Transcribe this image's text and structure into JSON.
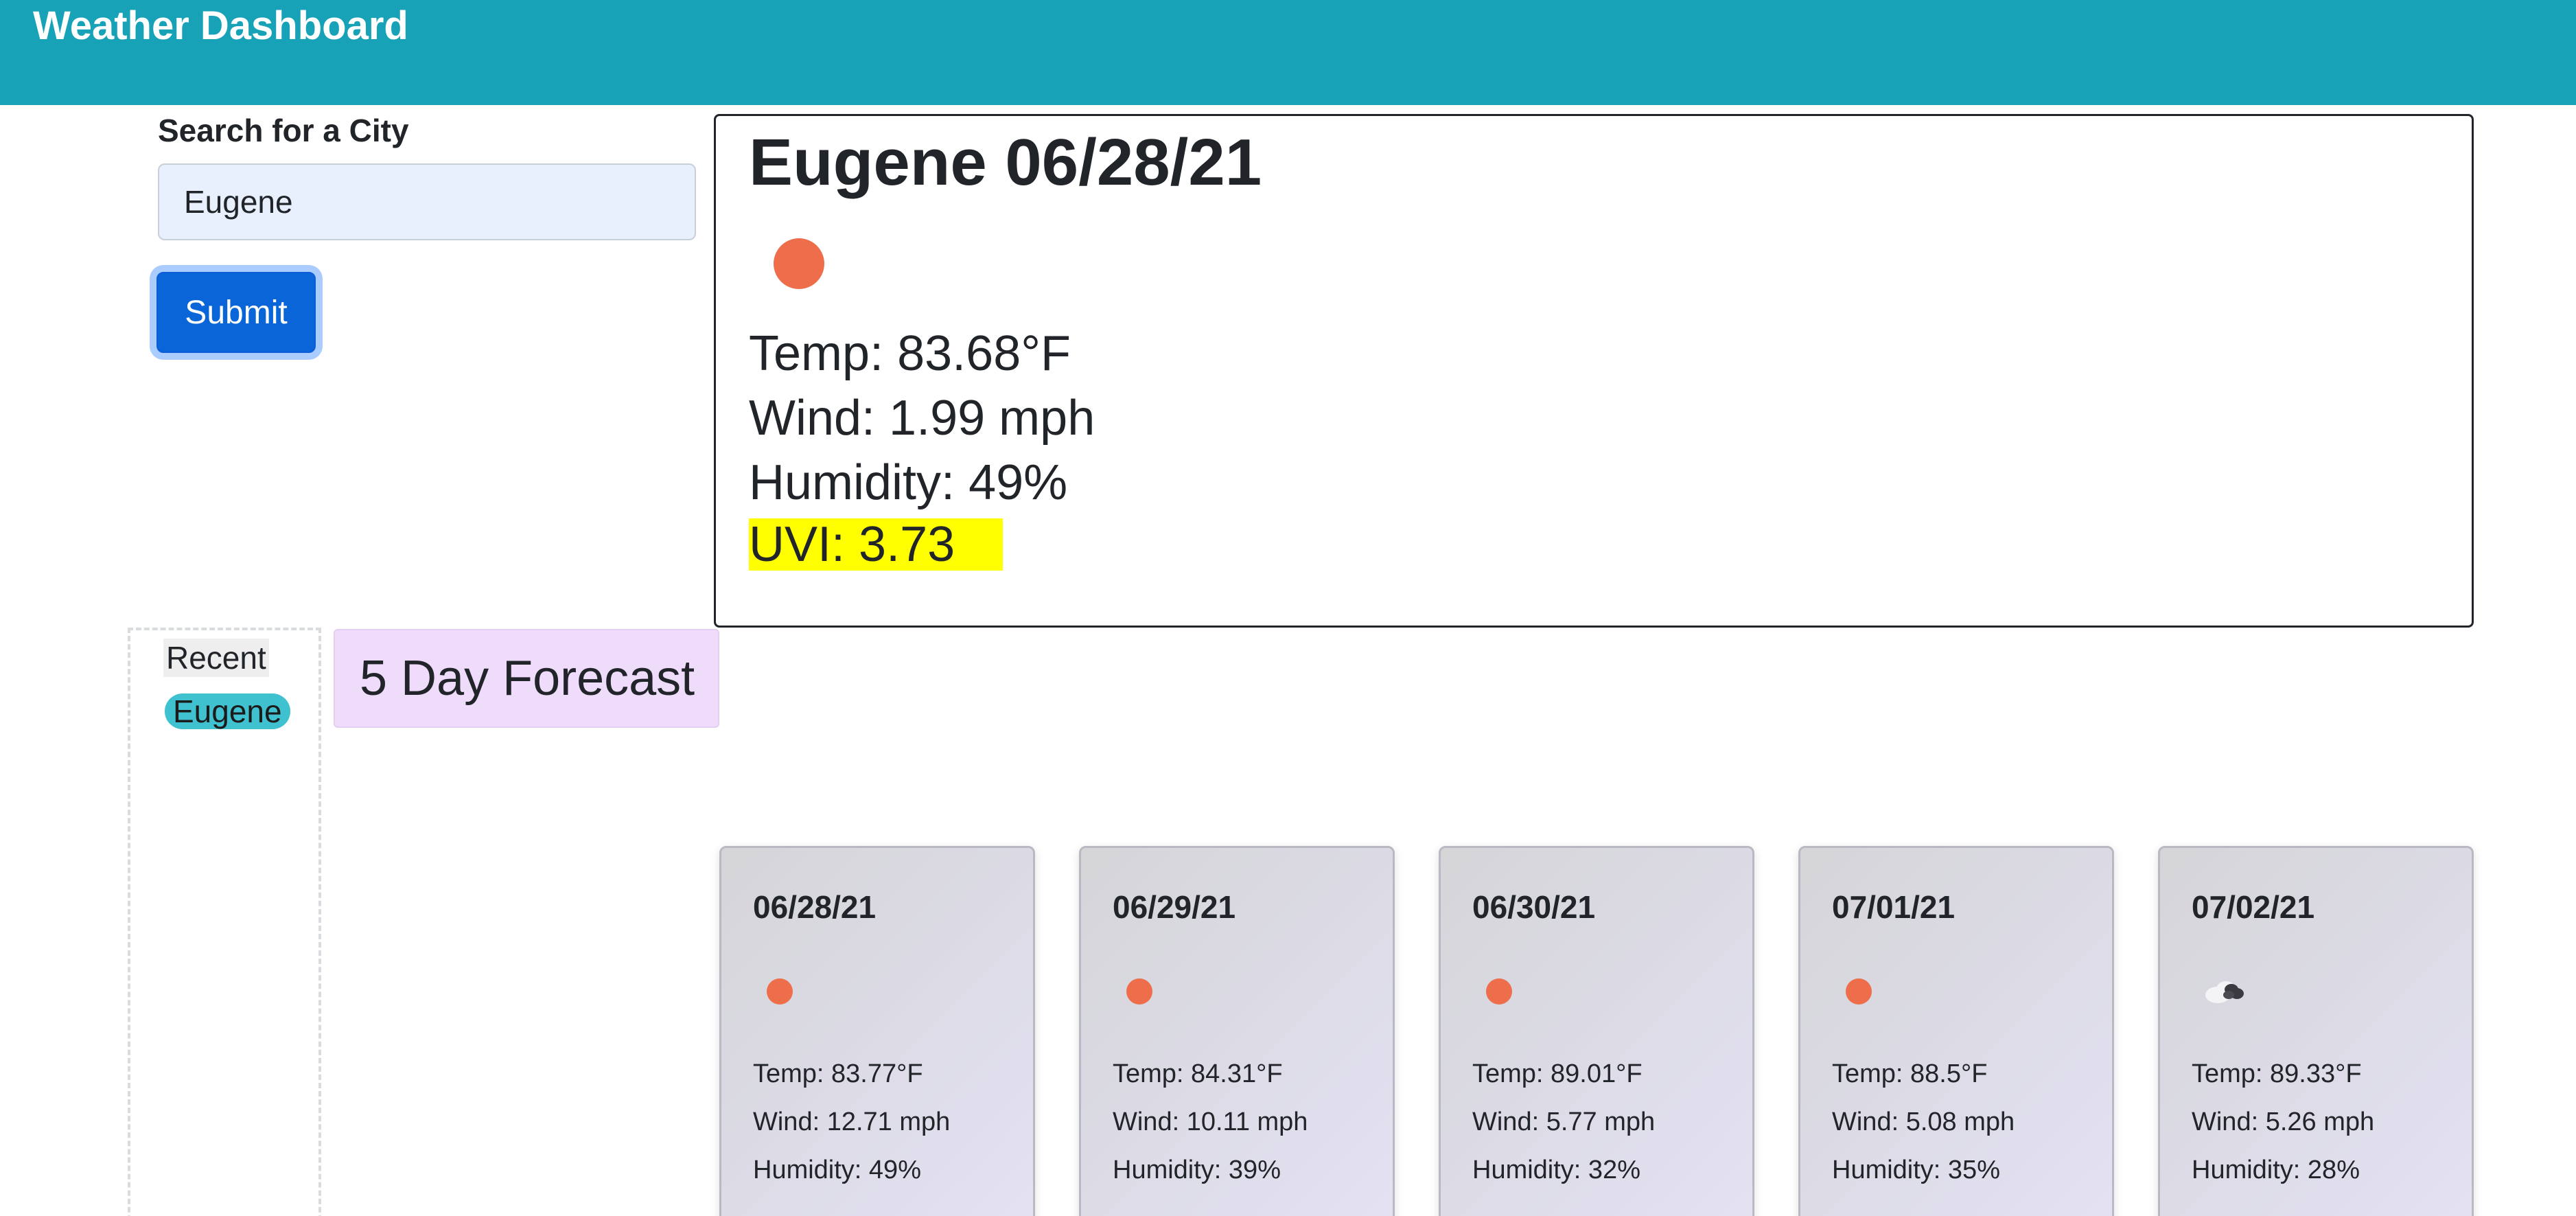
{
  "header": {
    "title": "Weather Dashboard"
  },
  "search": {
    "label": "Search for a City",
    "value": "Eugene",
    "submit_label": "Submit"
  },
  "current": {
    "title": "Eugene 06/28/21",
    "icon": "sun-icon",
    "temp": "Temp: 83.68°F",
    "wind": "Wind: 1.99 mph",
    "humidity": "Humidity: 49%",
    "uvi": "UVI: 3.73",
    "uvi_color": "#ffff00"
  },
  "recent": {
    "label": "Recent",
    "items": [
      "Eugene"
    ]
  },
  "forecast": {
    "heading": "5 Day Forecast",
    "days": [
      {
        "date": "06/28/21",
        "icon": "sun-icon",
        "temp": "Temp: 83.77°F",
        "wind": "Wind: 12.71 mph",
        "humidity": "Humidity: 49%"
      },
      {
        "date": "06/29/21",
        "icon": "sun-icon",
        "temp": "Temp: 84.31°F",
        "wind": "Wind: 10.11 mph",
        "humidity": "Humidity: 39%"
      },
      {
        "date": "06/30/21",
        "icon": "sun-icon",
        "temp": "Temp: 89.01°F",
        "wind": "Wind: 5.77 mph",
        "humidity": "Humidity: 32%"
      },
      {
        "date": "07/01/21",
        "icon": "sun-icon",
        "temp": "Temp: 88.5°F",
        "wind": "Wind: 5.08 mph",
        "humidity": "Humidity: 35%"
      },
      {
        "date": "07/02/21",
        "icon": "cloud-icon",
        "temp": "Temp: 89.33°F",
        "wind": "Wind: 5.26 mph",
        "humidity": "Humidity: 28%"
      }
    ]
  },
  "colors": {
    "header_bg": "#17a2b8",
    "accent_button": "#0a66d8",
    "sun": "#ee6e4b",
    "recent_chip": "#3fc1cf",
    "forecast_heading_bg": "#efdcfa"
  }
}
